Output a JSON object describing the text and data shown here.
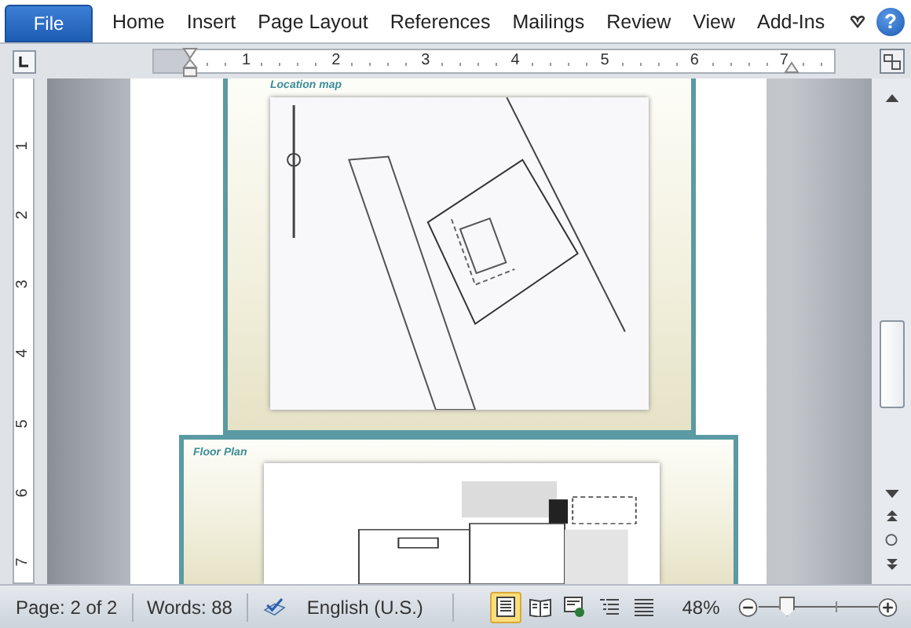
{
  "ribbon": {
    "file_tab": "File",
    "tabs": [
      {
        "label": "Home",
        "selected": false
      },
      {
        "label": "Insert",
        "selected": false
      },
      {
        "label": "Page Layout",
        "selected": false
      },
      {
        "label": "References",
        "selected": false
      },
      {
        "label": "Mailings",
        "selected": false
      },
      {
        "label": "Review",
        "selected": false
      },
      {
        "label": "View",
        "selected": false
      },
      {
        "label": "Add-Ins",
        "selected": false
      }
    ],
    "help": "?"
  },
  "ruler": {
    "horizontal": [
      "1",
      "2",
      "3",
      "4",
      "5",
      "6",
      "7"
    ],
    "vertical": [
      "1",
      "2",
      "3",
      "4",
      "5",
      "6",
      "7"
    ]
  },
  "document": {
    "sections": [
      {
        "label": "Location map",
        "kind": "picture"
      },
      {
        "label": "Floor Plan",
        "kind": "picture"
      }
    ]
  },
  "status_bar": {
    "page": "Page: 2 of 2",
    "words": "Words: 88",
    "language": "English (U.S.)",
    "views": [
      {
        "kind": "print_layout",
        "selected": true
      },
      {
        "kind": "reading",
        "selected": false
      },
      {
        "kind": "web",
        "selected": false
      },
      {
        "kind": "outline",
        "selected": false
      },
      {
        "kind": "draft",
        "selected": false
      }
    ],
    "zoom": "48%",
    "zoom_slider": {
      "level": 0.24
    }
  }
}
